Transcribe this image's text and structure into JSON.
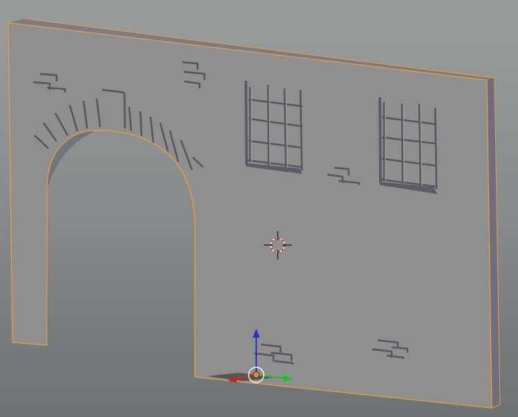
{
  "app": {
    "name": "3D viewport",
    "viewport_title": ""
  },
  "scene": {
    "object": "wall-with-archway",
    "selected": true,
    "colors": {
      "background_top": "#9a9c9c",
      "background_bottom": "#6f7274",
      "wall_face": "#8f8f8f",
      "wall_side": "#6e6e7e",
      "wall_top": "#7c7c88",
      "selection_outline": "#f0a030",
      "relief_shadow": "#55555f",
      "relief_highlight": "#a4a4a4"
    },
    "icons": {
      "cursor": "3d-cursor-icon",
      "gizmo": "transform-gizmo-icon"
    },
    "gizmo_axes": {
      "x_color": "#d02020",
      "y_color": "#20c020",
      "z_color": "#2030d0",
      "pivot_color": "#e08a30"
    }
  }
}
